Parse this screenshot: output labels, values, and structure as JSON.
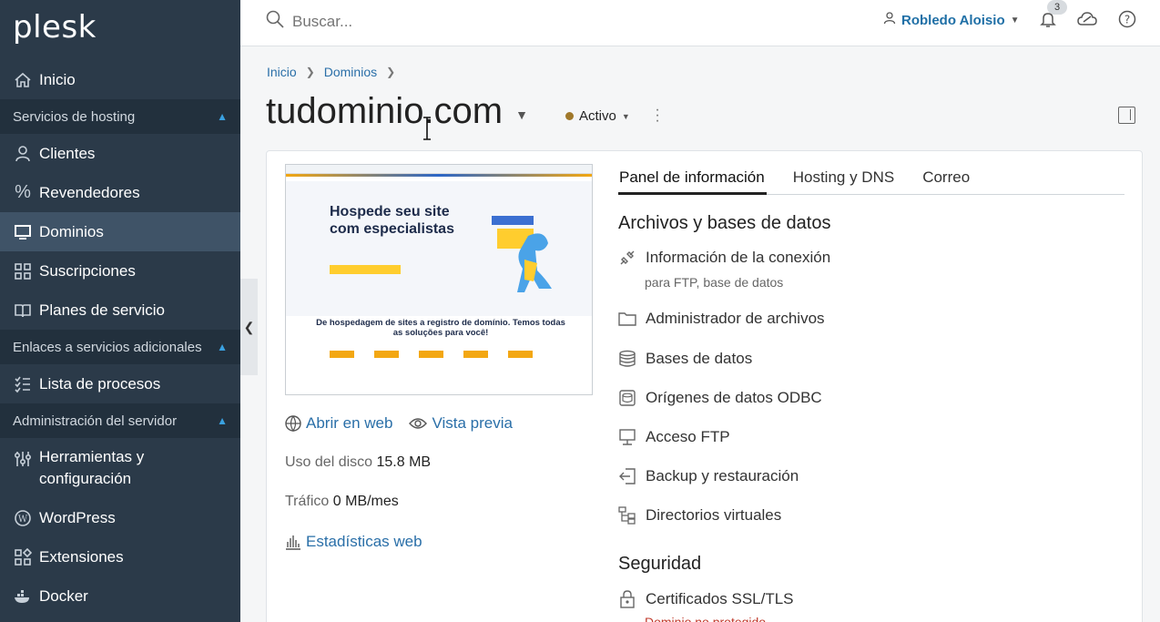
{
  "app": {
    "logo": "plesk"
  },
  "sidebar": {
    "items": [
      {
        "label": "Inicio",
        "icon": "home-icon"
      },
      {
        "section": "Servicios de hosting"
      },
      {
        "label": "Clientes",
        "icon": "user-icon"
      },
      {
        "label": "Revendedores",
        "icon": "percent-icon"
      },
      {
        "label": "Dominios",
        "icon": "monitor-icon",
        "active": true
      },
      {
        "label": "Suscripciones",
        "icon": "grid-icon"
      },
      {
        "label": "Planes de servicio",
        "icon": "book-icon"
      },
      {
        "section": "Enlaces a servicios adicionales"
      },
      {
        "label": "Lista de procesos",
        "icon": "checklist-icon"
      },
      {
        "section": "Administración del servidor"
      },
      {
        "label": "Herramientas y configuración",
        "icon": "sliders-icon"
      },
      {
        "label": "WordPress",
        "icon": "wordpress-icon"
      },
      {
        "label": "Extensiones",
        "icon": "extensions-icon"
      },
      {
        "label": "Docker",
        "icon": "docker-icon"
      }
    ]
  },
  "topbar": {
    "search_placeholder": "Buscar...",
    "user_name": "Robledo Aloisio",
    "notifications_count": "3"
  },
  "breadcrumb": {
    "home": "Inicio",
    "domains": "Dominios"
  },
  "page": {
    "title": "tudominio.com",
    "status": "Activo",
    "status_color": "#a0782a"
  },
  "preview": {
    "headline": "Hospede seu site com especialistas",
    "subheadline": "De hospedagem de sites a registro de domínio. Temos todas as soluções para você!"
  },
  "site_links": {
    "open_web": "Abrir en web",
    "preview": "Vista previa"
  },
  "stats": {
    "disk_label": "Uso del disco",
    "disk_value": "15.8 MB",
    "traffic_label": "Tráfico",
    "traffic_value": "0 MB/mes",
    "web_stats": "Estadísticas web"
  },
  "tabs": [
    "Panel de información",
    "Hosting y DNS",
    "Correo"
  ],
  "sections": {
    "files_title": "Archivos y bases de datos",
    "connection_info": "Información de la conexión",
    "connection_sub": "para FTP, base de datos",
    "file_manager": "Administrador de archivos",
    "databases": "Bases de datos",
    "odbc": "Orígenes de datos ODBC",
    "ftp": "Acceso FTP",
    "backup": "Backup y restauración",
    "virtual_dirs": "Directorios virtuales",
    "security_title": "Seguridad",
    "ssl": "Certificados SSL/TLS",
    "ssl_warning": "Dominio no protegido"
  },
  "colors": {
    "sidebar": "#2b3a49",
    "link": "#2a6fa8",
    "accent": "#3aa1e0"
  }
}
